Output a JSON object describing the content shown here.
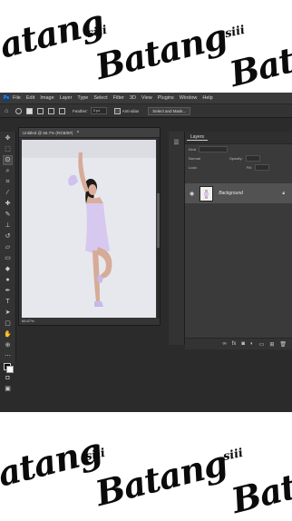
{
  "watermark": {
    "brand": "Batang",
    "prefix": "siii"
  },
  "menubar": {
    "logo": "Ps",
    "items": [
      "File",
      "Edit",
      "Image",
      "Layer",
      "Type",
      "Select",
      "Filter",
      "3D",
      "View",
      "Plugins",
      "Window",
      "Help"
    ]
  },
  "options_bar": {
    "feather_label": "Feather:",
    "feather_value": "0 px",
    "anti_alias_label": "Anti-alias",
    "select_mask_label": "Select and Mask..."
  },
  "document": {
    "tab_title": "Untitled @ 66.7% (RGB/8#)",
    "close": "×",
    "zoom": "66.67%"
  },
  "layers_panel": {
    "tab": "Layers",
    "kind_label": "Kind",
    "mode_label": "Normal",
    "opacity_label": "Opacity:",
    "lock_label": "Lock:",
    "fill_label": "Fill:",
    "layer_name": "Background"
  },
  "colors": {
    "ps_bg": "#2b2b2b",
    "panel_bg": "#3a3a3a",
    "canvas_bg": "#e9eaef",
    "dress": "#d7c8f0"
  }
}
